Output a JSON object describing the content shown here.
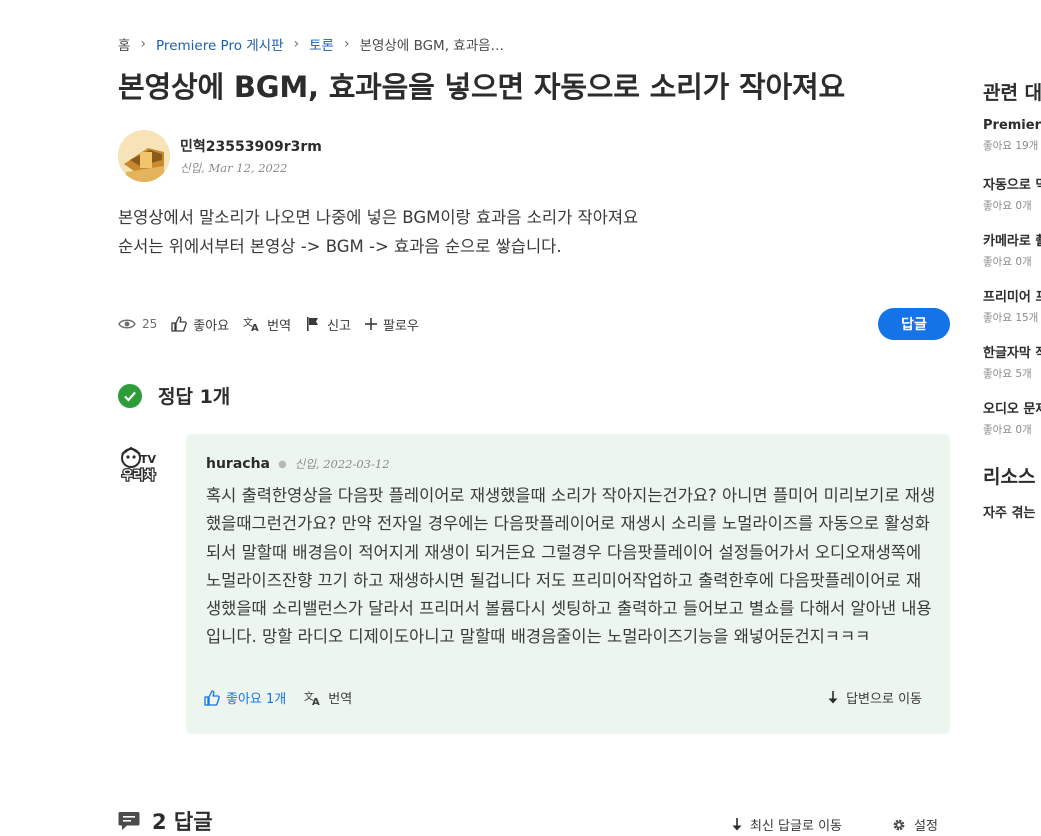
{
  "breadcrumb": {
    "home": "홈",
    "board": "Premiere Pro 게시판",
    "category": "토론",
    "current": "본영상에 BGM, 효과음…"
  },
  "post": {
    "title": "본영상에 BGM, 효과음을 넣으면 자동으로 소리가 작아져요",
    "author": "민혁23553909r3rm",
    "author_meta": "신입, Mar 12, 2022",
    "body_line1": "본영상에서 말소리가 나오면 나중에 넣은 BGM이랑 효과음 소리가 작아져요",
    "body_line2": "순서는 위에서부터 본영상 -> BGM -> 효과음 순으로 쌓습니다."
  },
  "actions": {
    "views": "25",
    "like": "좋아요",
    "translate": "번역",
    "report": "신고",
    "follow": "팔로우",
    "reply": "답글"
  },
  "solution": {
    "heading": "정답 1개",
    "user": "huracha",
    "meta": "신입, 2022-03-12",
    "text": "혹시 출력한영상을 다음팟 플레이어로 재생했을때 소리가 작아지는건가요? 아니면 플미어 미리보기로 재생했을때그런건가요? 만약 전자일 경우에는 다음팟플레이어로 재생시 소리를 노멀라이즈를 자동으로 활성화되서 말할때 배경음이 적어지게 재생이 되거든요 그럴경우 다음팟플레이어 설정들어가서 오디오재생쪽에 노멀라이즈잔향 끄기 하고 재생하시면 될겁니다 저도 프리미어작업하고 출력한후에 다음팟플레이어로 재생했을때 소리밸런스가 달라서 프리머서 볼륨다시 셋팅하고 출력하고 들어보고 별쇼를 다해서 알아낸 내용입니다.  망할 라디오 디제이도아니고 말할때 배경음줄이는 노멀라이즈기능을 왜넣어둔건지ㅋㅋㅋ",
    "like": "좋아요 1개",
    "translate": "번역",
    "jump": "답변으로 이동"
  },
  "replies": {
    "heading": "2 답글",
    "latest": "최신 답글로 이동",
    "settings": "설정"
  },
  "sidebar": {
    "related_heading": "관련 대",
    "items": [
      {
        "title": "Premiere",
        "likes": "좋아요 19개"
      },
      {
        "title": "자동으로 믹",
        "likes": "좋아요 0개"
      },
      {
        "title": "카메라로 촬",
        "likes": "좋아요 0개"
      },
      {
        "title": "프리미어 프",
        "likes": "좋아요 15개"
      },
      {
        "title": "한글자막 작",
        "likes": "좋아요 5개"
      },
      {
        "title": "오디오 문제",
        "likes": "좋아요 0개"
      }
    ],
    "resources_heading": "리소스",
    "faq": "자주 겪는"
  },
  "colors": {
    "accent": "#1473e6",
    "link": "#1d5fa8",
    "solution_bg": "#edf6ee",
    "check": "#2d9d3a"
  }
}
